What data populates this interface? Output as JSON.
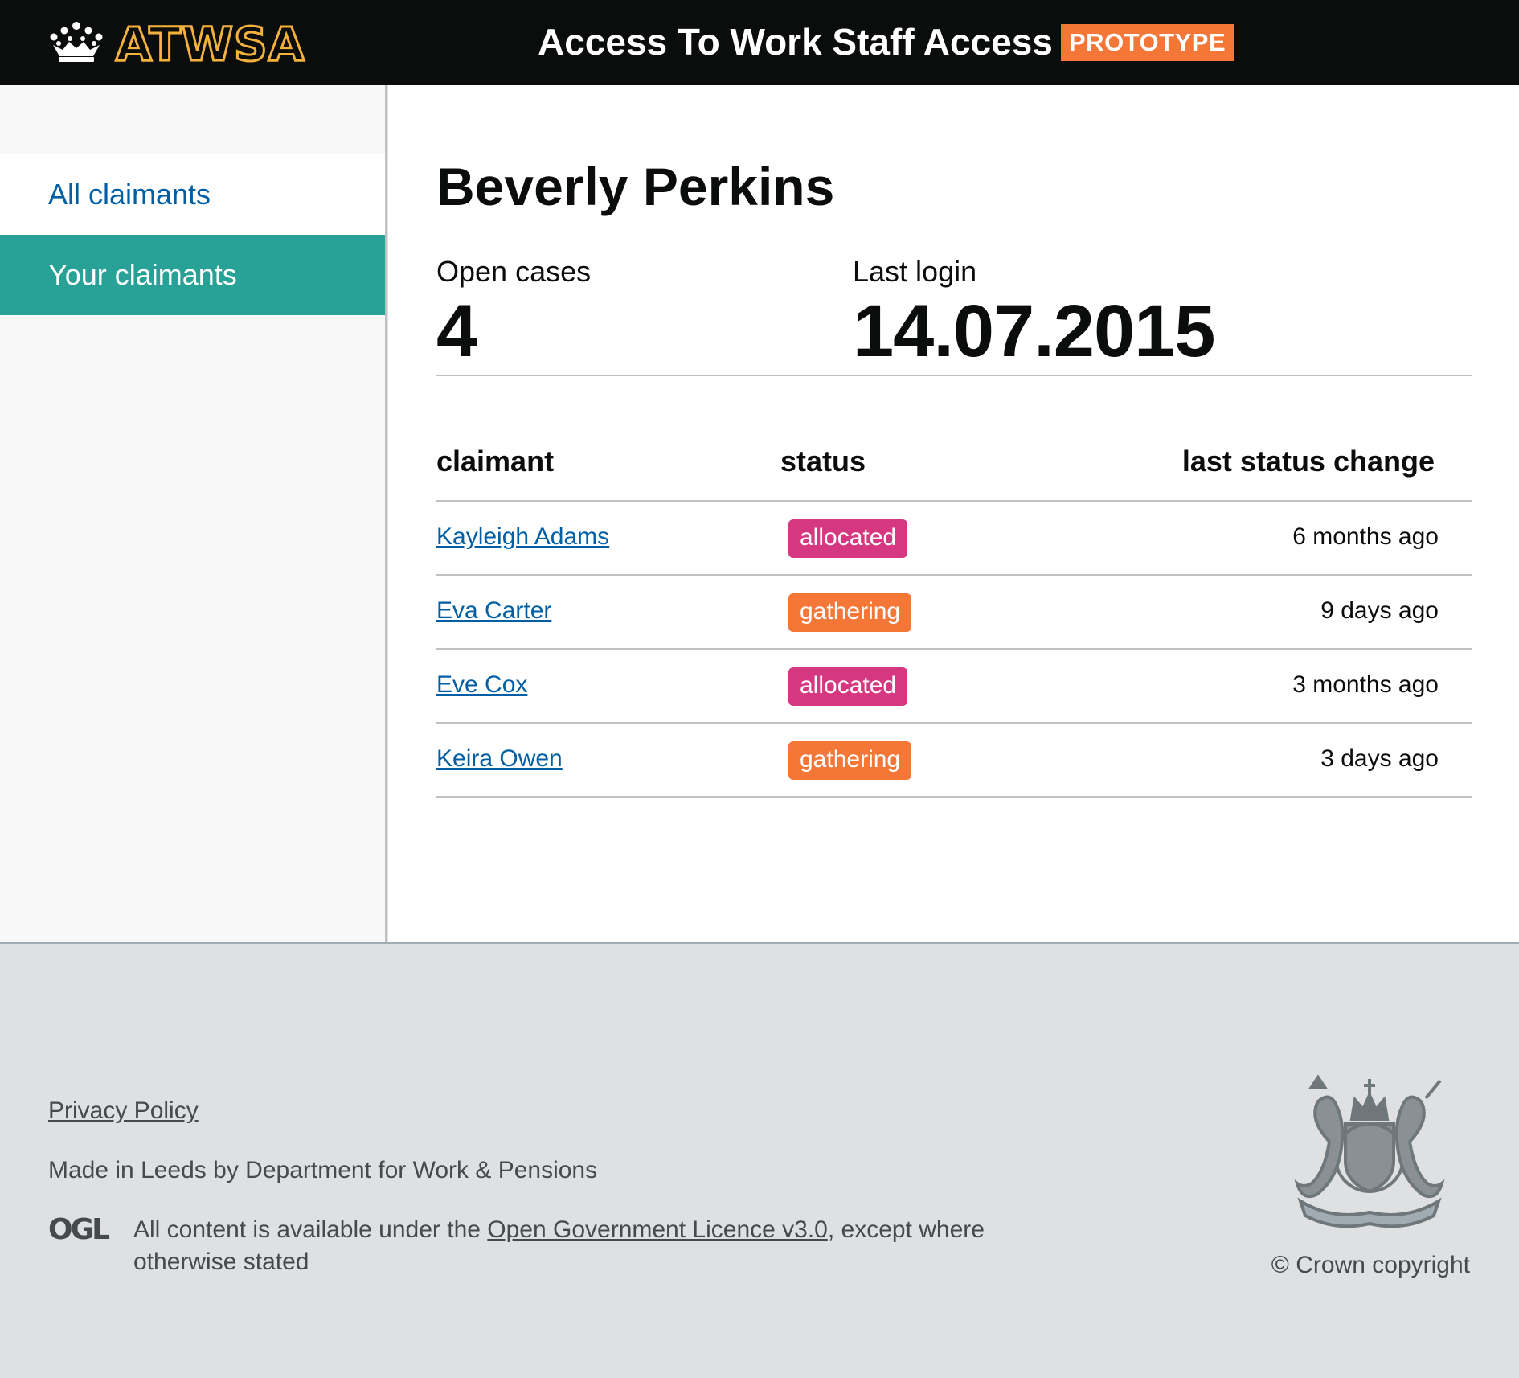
{
  "header": {
    "logo_text": "ATWSA",
    "app_title": "Access To Work Staff Access",
    "phase_tag": "PROTOTYPE"
  },
  "sidebar": {
    "items": [
      {
        "label": "All claimants",
        "active": false
      },
      {
        "label": "Your claimants",
        "active": true
      }
    ]
  },
  "main": {
    "name": "Beverly Perkins",
    "stats": {
      "open_cases_label": "Open cases",
      "open_cases_value": "4",
      "last_login_label": "Last login",
      "last_login_value": "14.07.2015"
    },
    "table": {
      "headers": [
        "claimant",
        "status",
        "last status change"
      ],
      "rows": [
        {
          "claimant": "Kayleigh Adams",
          "status": "allocated",
          "last_change": "6 months ago"
        },
        {
          "claimant": "Eva Carter",
          "status": "gathering",
          "last_change": "9 days ago"
        },
        {
          "claimant": "Eve Cox",
          "status": "allocated",
          "last_change": "3 months ago"
        },
        {
          "claimant": "Keira Owen",
          "status": "gathering",
          "last_change": "3 days ago"
        }
      ]
    }
  },
  "footer": {
    "privacy_link": "Privacy Policy",
    "made_in": "Made in Leeds by Department for Work & Pensions",
    "ogl_logo_text": "OGL",
    "licence_prefix": "All content is available under the ",
    "licence_link": "Open Government Licence v3.0",
    "licence_suffix": ", except where otherwise stated",
    "copyright": "© Crown copyright"
  },
  "colors": {
    "header_bg": "#0b0c0c",
    "logo_outline": "#f4b13c",
    "phase_tag": "#f47738",
    "active_nav": "#28a197",
    "link": "#005ea5",
    "allocated": "#d53880",
    "gathering": "#f47738",
    "footer_bg": "#dee0e2"
  },
  "icons": {
    "crown": "crown-icon",
    "ogl": "ogl-logo-icon",
    "crest": "royal-coat-of-arms-icon"
  }
}
